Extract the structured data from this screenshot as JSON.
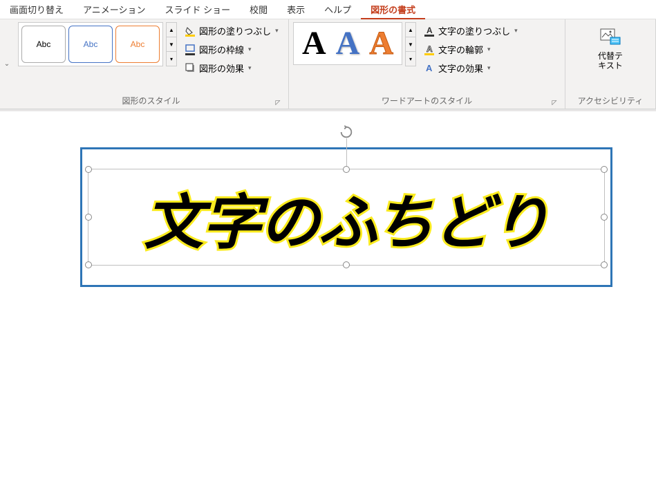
{
  "tabs": [
    {
      "label": "画面切り替え"
    },
    {
      "label": "アニメーション"
    },
    {
      "label": "スライド ショー"
    },
    {
      "label": "校閲"
    },
    {
      "label": "表示"
    },
    {
      "label": "ヘルプ"
    },
    {
      "label": "図形の書式",
      "active": true
    }
  ],
  "shape_styles": {
    "preview_label": "Abc",
    "fill": "図形の塗りつぶし",
    "outline": "図形の枠線",
    "effects": "図形の効果",
    "group_label": "図形のスタイル"
  },
  "wordart_styles": {
    "textfill": "文字の塗りつぶし",
    "textoutline": "文字の輪郭",
    "texteffects": "文字の効果",
    "group_label": "ワードアートのスタイル"
  },
  "alt_text": {
    "label_l1": "代替テ",
    "label_l2": "キスト",
    "group_label": "アクセシビリティ"
  },
  "slide": {
    "text": "文字のふちどり"
  }
}
